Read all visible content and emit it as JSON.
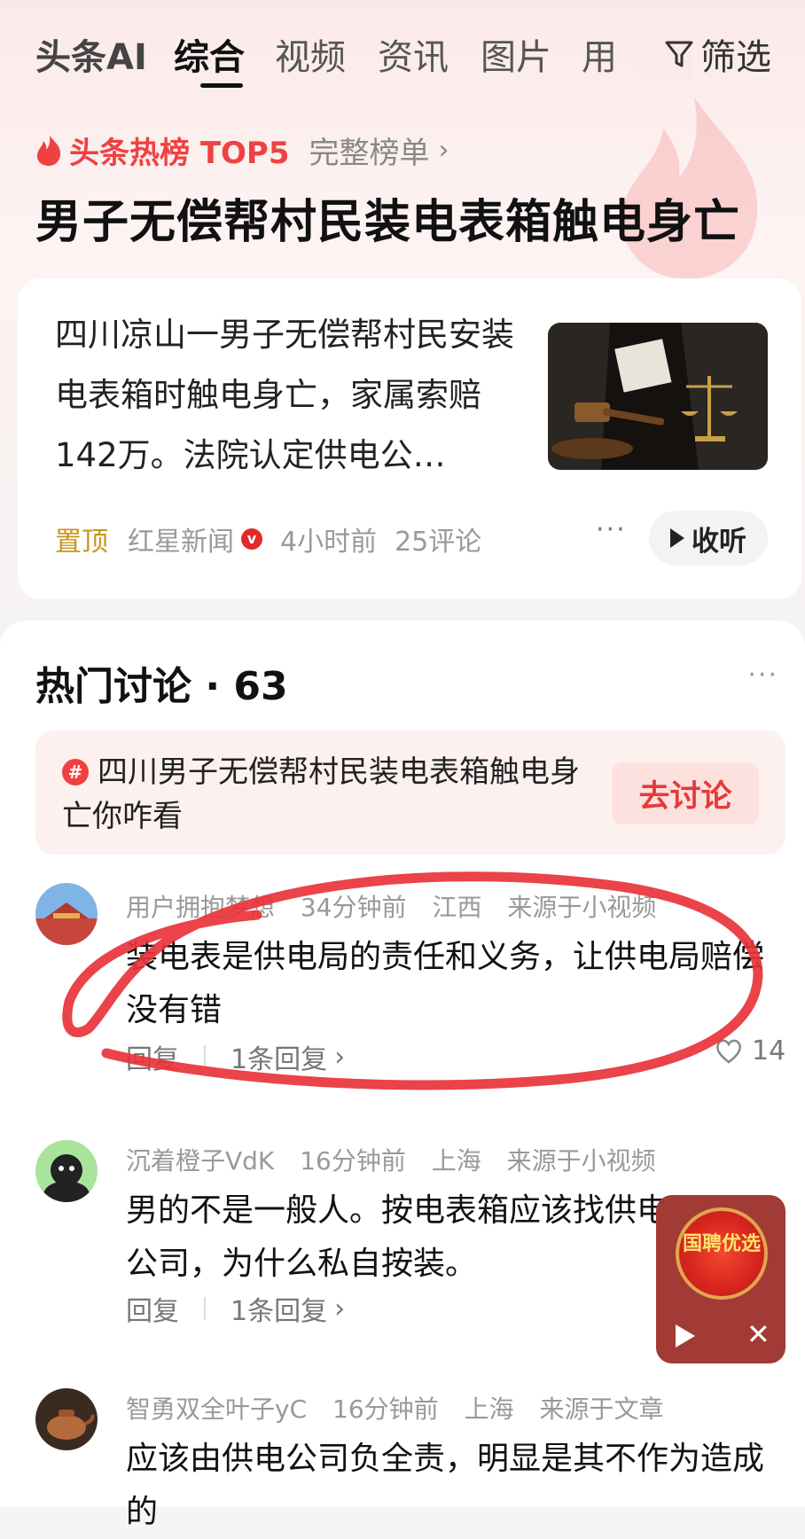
{
  "nav": {
    "brand": "头条AI",
    "tabs": [
      "综合",
      "视频",
      "资讯",
      "图片",
      "用"
    ],
    "filter_label": "筛选"
  },
  "hot": {
    "title": "头条热榜 TOP5",
    "full_list": "完整榜单",
    "headline": "男子无偿帮村民装电表箱触电身亡"
  },
  "article": {
    "text": "四川凉山一男子无偿帮村民安装电表箱时触电身亡，家属索赔142万。法院认定供电公…",
    "pin": "置顶",
    "source": "红星新闻",
    "time": "4小时前",
    "comments": "25评论",
    "listen": "收听"
  },
  "discussion": {
    "title": "热门讨论",
    "count": "63",
    "topic": "四川男子无偿帮村民装电表箱触电身亡你咋看",
    "go_button": "去讨论"
  },
  "comments": [
    {
      "user": "用户拥抱梦想",
      "time": "34分钟前",
      "location": "江西",
      "source": "来源于小视频",
      "text": "装电表是供电局的责任和义务，让供电局赔偿没有错",
      "reply_label": "回复",
      "replies": "1条回复",
      "likes": "14"
    },
    {
      "user": "沉着橙子VdK",
      "time": "16分钟前",
      "location": "上海",
      "source": "来源于小视频",
      "text": "男的不是一般人。按电表箱应该找供电公司，为什么私自按装。",
      "reply_label": "回复",
      "replies": "1条回复"
    },
    {
      "user": "智勇双全叶子yC",
      "time": "16分钟前",
      "location": "上海",
      "source": "来源于文章",
      "text": "应该由供电公司负全责，明显是其不作为造成的",
      "reply_label": "回复",
      "replies": ""
    }
  ],
  "mini_player": {
    "logo_text": "国聘优选"
  },
  "colors": {
    "accent_red": "#f04142",
    "pin_gold": "#c9951a",
    "annotation_red": "#e8333a"
  }
}
